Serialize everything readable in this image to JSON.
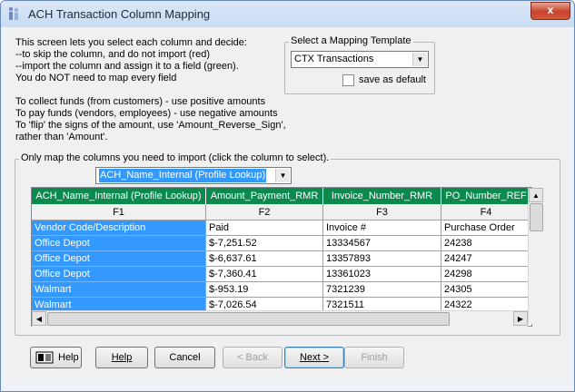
{
  "window": {
    "title": "ACH Transaction Column Mapping",
    "close_glyph": "x"
  },
  "intro_lines": [
    "This screen lets you select each column and decide:",
    "--to skip the column, and do not import (red)",
    "--import the column and assign it to a field (green).",
    "You do NOT need to map every field",
    "",
    "To collect funds (from customers) - use positive amounts",
    "To pay funds (vendors, employees) - use negative amounts",
    "To 'flip' the signs of the amount, use 'Amount_Reverse_Sign',",
    "rather than 'Amount'."
  ],
  "template": {
    "legend": "Select a Mapping Template",
    "selected": "CTX Transactions",
    "save_default_label": "save as default",
    "save_default_checked": false
  },
  "mapping": {
    "legend": "Only map the columns you need to import (click the column to select).",
    "field_selected": "ACH_Name_Internal (Profile Lookup)"
  },
  "grid": {
    "headers": [
      "ACH_Name_Internal (Profile Lookup)",
      "Amount_Payment_RMR",
      "Invoice_Number_RMR",
      "PO_Number_REF"
    ],
    "file_columns": [
      "F1",
      "F2",
      "F3",
      "F4"
    ],
    "rows": [
      [
        "Vendor Code/Description",
        "Paid",
        "Invoice #",
        "Purchase Order"
      ],
      [
        "Office Depot",
        "$-7,251.52",
        "13334567",
        "24238"
      ],
      [
        "Office Depot",
        "$-6,637.61",
        "13357893",
        "24247"
      ],
      [
        "Office Depot",
        "$-7,360.41",
        "13361023",
        "24298"
      ],
      [
        "Walmart",
        "$-953.19",
        "7321239",
        "24305"
      ],
      [
        "Walmart",
        "$-7,026.54",
        "7321511",
        "24322"
      ]
    ],
    "selected_column": 0,
    "colors": {
      "header_bg": "#0c8a4d",
      "selected_bg": "#3399ff"
    }
  },
  "buttons": {
    "help_icon_label": "Help",
    "help": "Help",
    "cancel": "Cancel",
    "back": "< Back",
    "next": "Next >",
    "finish": "Finish"
  }
}
